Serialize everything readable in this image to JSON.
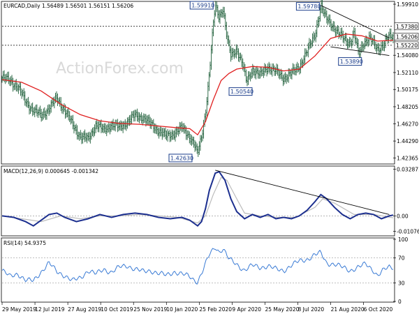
{
  "chart_data": [
    {
      "type": "candlestick",
      "title": "EURCAD,Daily  1.56489 1.56501 1.56151 1.56206",
      "watermark": "ActionForex.com",
      "y_ticks": [
        "1.59910",
        "1.57380",
        "1.56206",
        "1.55220",
        "1.54080",
        "1.52110",
        "1.50175",
        "1.48205",
        "1.46270",
        "1.44290",
        "1.42365"
      ],
      "y_range": [
        1.4175,
        1.6015
      ],
      "level_lines": [
        1.5738,
        1.5522
      ],
      "last_price": 1.56206,
      "annotations": [
        {
          "text": "1.59910",
          "x": 0.545,
          "y": 1.5991
        },
        {
          "text": "1.59780",
          "x": 0.815,
          "y": 1.5978
        },
        {
          "text": "1.50540",
          "x": 0.625,
          "y": 1.5054
        },
        {
          "text": "1.53890",
          "x": 0.912,
          "y": 1.5389
        },
        {
          "text": "1.42630",
          "x": 0.5,
          "y": 1.4263
        }
      ],
      "price_path": [
        [
          0,
          1.515
        ],
        [
          0.02,
          1.512
        ],
        [
          0.04,
          1.505
        ],
        [
          0.06,
          1.488
        ],
        [
          0.08,
          1.478
        ],
        [
          0.1,
          1.472
        ],
        [
          0.12,
          1.48
        ],
        [
          0.14,
          1.492
        ],
        [
          0.16,
          1.478
        ],
        [
          0.18,
          1.462
        ],
        [
          0.2,
          1.448
        ],
        [
          0.22,
          1.445
        ],
        [
          0.24,
          1.462
        ],
        [
          0.26,
          1.455
        ],
        [
          0.28,
          1.462
        ],
        [
          0.3,
          1.458
        ],
        [
          0.32,
          1.465
        ],
        [
          0.34,
          1.472
        ],
        [
          0.36,
          1.47
        ],
        [
          0.38,
          1.462
        ],
        [
          0.4,
          1.455
        ],
        [
          0.42,
          1.448
        ],
        [
          0.44,
          1.452
        ],
        [
          0.46,
          1.458
        ],
        [
          0.48,
          1.448
        ],
        [
          0.49,
          1.44
        ],
        [
          0.5,
          1.428
        ],
        [
          0.51,
          1.448
        ],
        [
          0.52,
          1.475
        ],
        [
          0.53,
          1.52
        ],
        [
          0.54,
          1.575
        ],
        [
          0.545,
          1.597
        ],
        [
          0.555,
          1.585
        ],
        [
          0.565,
          1.595
        ],
        [
          0.575,
          1.56
        ],
        [
          0.585,
          1.54
        ],
        [
          0.6,
          1.548
        ],
        [
          0.615,
          1.53
        ],
        [
          0.625,
          1.51
        ],
        [
          0.64,
          1.525
        ],
        [
          0.66,
          1.518
        ],
        [
          0.68,
          1.528
        ],
        [
          0.7,
          1.522
        ],
        [
          0.72,
          1.515
        ],
        [
          0.74,
          1.52
        ],
        [
          0.76,
          1.528
        ],
        [
          0.78,
          1.545
        ],
        [
          0.8,
          1.565
        ],
        [
          0.81,
          1.585
        ],
        [
          0.815,
          1.598
        ],
        [
          0.825,
          1.585
        ],
        [
          0.84,
          1.578
        ],
        [
          0.86,
          1.565
        ],
        [
          0.875,
          1.56
        ],
        [
          0.89,
          1.555
        ],
        [
          0.9,
          1.565
        ],
        [
          0.912,
          1.542
        ],
        [
          0.925,
          1.556
        ],
        [
          0.94,
          1.56
        ],
        [
          0.96,
          1.548
        ],
        [
          0.975,
          1.553
        ],
        [
          0.99,
          1.562
        ],
        [
          1,
          1.562
        ]
      ],
      "sma_path": [
        [
          0,
          1.513
        ],
        [
          0.05,
          1.51
        ],
        [
          0.1,
          1.5
        ],
        [
          0.15,
          1.485
        ],
        [
          0.2,
          1.473
        ],
        [
          0.25,
          1.466
        ],
        [
          0.3,
          1.463
        ],
        [
          0.35,
          1.462
        ],
        [
          0.4,
          1.46
        ],
        [
          0.45,
          1.458
        ],
        [
          0.48,
          1.457
        ],
        [
          0.5,
          1.45
        ],
        [
          0.52,
          1.465
        ],
        [
          0.54,
          1.49
        ],
        [
          0.56,
          1.512
        ],
        [
          0.58,
          1.52
        ],
        [
          0.6,
          1.525
        ],
        [
          0.64,
          1.528
        ],
        [
          0.68,
          1.527
        ],
        [
          0.72,
          1.523
        ],
        [
          0.76,
          1.525
        ],
        [
          0.8,
          1.54
        ],
        [
          0.84,
          1.56
        ],
        [
          0.88,
          1.565
        ],
        [
          0.92,
          1.563
        ],
        [
          0.96,
          1.557
        ],
        [
          1,
          1.558
        ]
      ],
      "trendlines": [
        {
          "from": [
            0.815,
            1.5978
          ],
          "to": [
            0.99,
            1.5605
          ]
        },
        {
          "from": [
            0.84,
            1.5505
          ],
          "to": [
            0.99,
            1.5405
          ]
        }
      ],
      "x_ticks": [
        "29 May 2019",
        "12 Jul 2019",
        "27 Aug 2019",
        "10 Oct 2019",
        "25 Nov 2019",
        "10 Jan 2020",
        "25 Feb 2020",
        "9 Apr 2020",
        "25 May 2020",
        "8 Jul 2020",
        "21 Aug 2020",
        "6 Oct 2020"
      ]
    },
    {
      "type": "line",
      "title": "MACD(12,26,9) 0.000645 -0.001342",
      "y_ticks": [
        "0.032871",
        "0.00",
        "-0.010762"
      ],
      "y_range": [
        -0.0135,
        0.0345
      ],
      "zero": 0,
      "macd_path": [
        [
          0,
          0.0
        ],
        [
          0.03,
          -0.001
        ],
        [
          0.06,
          -0.004
        ],
        [
          0.08,
          -0.007
        ],
        [
          0.1,
          -0.003
        ],
        [
          0.12,
          0.001
        ],
        [
          0.14,
          0.002
        ],
        [
          0.16,
          -0.001
        ],
        [
          0.19,
          -0.004
        ],
        [
          0.22,
          -0.002
        ],
        [
          0.25,
          0.001
        ],
        [
          0.28,
          -0.001
        ],
        [
          0.31,
          0.001
        ],
        [
          0.34,
          0.002
        ],
        [
          0.37,
          0.001
        ],
        [
          0.4,
          -0.001
        ],
        [
          0.43,
          -0.002
        ],
        [
          0.46,
          -0.001
        ],
        [
          0.48,
          -0.003
        ],
        [
          0.5,
          -0.007
        ],
        [
          0.51,
          -0.004
        ],
        [
          0.52,
          0.005
        ],
        [
          0.53,
          0.018
        ],
        [
          0.545,
          0.03
        ],
        [
          0.555,
          0.031
        ],
        [
          0.57,
          0.025
        ],
        [
          0.585,
          0.012
        ],
        [
          0.6,
          0.003
        ],
        [
          0.62,
          -0.002
        ],
        [
          0.64,
          0.001
        ],
        [
          0.66,
          -0.001
        ],
        [
          0.68,
          0.001
        ],
        [
          0.7,
          -0.002
        ],
        [
          0.72,
          -0.001
        ],
        [
          0.74,
          -0.002
        ],
        [
          0.76,
          0.0
        ],
        [
          0.78,
          0.004
        ],
        [
          0.8,
          0.01
        ],
        [
          0.815,
          0.015
        ],
        [
          0.83,
          0.012
        ],
        [
          0.85,
          0.006
        ],
        [
          0.87,
          0.001
        ],
        [
          0.89,
          -0.002
        ],
        [
          0.91,
          0.001
        ],
        [
          0.93,
          0.002
        ],
        [
          0.95,
          0.001
        ],
        [
          0.97,
          -0.002
        ],
        [
          0.99,
          0.0
        ],
        [
          1,
          0.0006
        ]
      ],
      "signal_path": [
        [
          0,
          0.0
        ],
        [
          0.05,
          -0.002
        ],
        [
          0.1,
          -0.004
        ],
        [
          0.15,
          0.0
        ],
        [
          0.2,
          -0.002
        ],
        [
          0.25,
          0.0
        ],
        [
          0.3,
          0.0
        ],
        [
          0.35,
          0.001
        ],
        [
          0.4,
          0.0
        ],
        [
          0.45,
          -0.001
        ],
        [
          0.5,
          -0.005
        ],
        [
          0.52,
          0.0
        ],
        [
          0.54,
          0.015
        ],
        [
          0.56,
          0.027
        ],
        [
          0.575,
          0.025
        ],
        [
          0.6,
          0.012
        ],
        [
          0.62,
          0.002
        ],
        [
          0.66,
          0.0
        ],
        [
          0.7,
          -0.001
        ],
        [
          0.75,
          -0.001
        ],
        [
          0.8,
          0.006
        ],
        [
          0.82,
          0.012
        ],
        [
          0.85,
          0.009
        ],
        [
          0.9,
          0.001
        ],
        [
          0.95,
          0.001
        ],
        [
          1,
          -0.0013
        ]
      ],
      "trendline": {
        "from": [
          0.545,
          0.0321
        ],
        "to": [
          0.99,
          0.001
        ]
      }
    },
    {
      "type": "line",
      "title": "RSI(14) 54.9375",
      "y_ticks": [
        "100",
        "70",
        "30",
        "0"
      ],
      "y_range": [
        0,
        100
      ],
      "rsi_path": [
        [
          0,
          50
        ],
        [
          0.02,
          40
        ],
        [
          0.04,
          45
        ],
        [
          0.06,
          34
        ],
        [
          0.08,
          33
        ],
        [
          0.1,
          48
        ],
        [
          0.12,
          62
        ],
        [
          0.14,
          48
        ],
        [
          0.16,
          42
        ],
        [
          0.18,
          33
        ],
        [
          0.2,
          38
        ],
        [
          0.22,
          50
        ],
        [
          0.24,
          44
        ],
        [
          0.26,
          52
        ],
        [
          0.28,
          47
        ],
        [
          0.3,
          55
        ],
        [
          0.32,
          58
        ],
        [
          0.34,
          52
        ],
        [
          0.36,
          48
        ],
        [
          0.38,
          50
        ],
        [
          0.4,
          45
        ],
        [
          0.42,
          42
        ],
        [
          0.44,
          48
        ],
        [
          0.46,
          44
        ],
        [
          0.48,
          40
        ],
        [
          0.49,
          35
        ],
        [
          0.5,
          32
        ],
        [
          0.51,
          45
        ],
        [
          0.52,
          60
        ],
        [
          0.53,
          75
        ],
        [
          0.545,
          88
        ],
        [
          0.555,
          80
        ],
        [
          0.565,
          85
        ],
        [
          0.58,
          68
        ],
        [
          0.6,
          60
        ],
        [
          0.62,
          50
        ],
        [
          0.64,
          58
        ],
        [
          0.66,
          55
        ],
        [
          0.68,
          57
        ],
        [
          0.7,
          52
        ],
        [
          0.72,
          50
        ],
        [
          0.74,
          58
        ],
        [
          0.76,
          65
        ],
        [
          0.78,
          68
        ],
        [
          0.8,
          75
        ],
        [
          0.815,
          78
        ],
        [
          0.83,
          62
        ],
        [
          0.85,
          60
        ],
        [
          0.87,
          55
        ],
        [
          0.89,
          50
        ],
        [
          0.91,
          55
        ],
        [
          0.93,
          60
        ],
        [
          0.95,
          50
        ],
        [
          0.96,
          42
        ],
        [
          0.975,
          50
        ],
        [
          0.99,
          55
        ],
        [
          1,
          55
        ]
      ]
    }
  ]
}
